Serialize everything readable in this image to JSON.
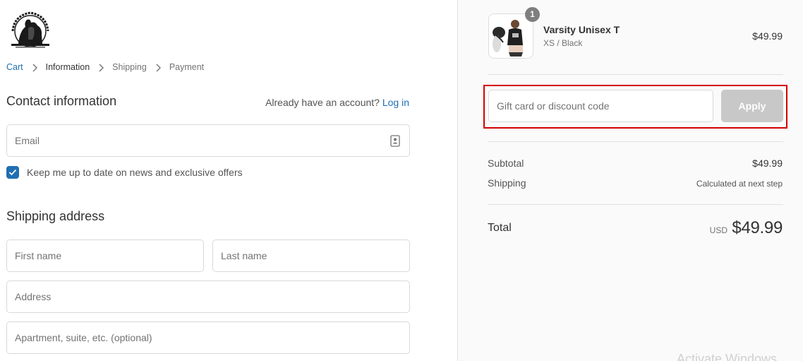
{
  "breadcrumb": {
    "items": [
      {
        "label": "Cart",
        "state": "link"
      },
      {
        "label": "Information",
        "state": "current"
      },
      {
        "label": "Shipping",
        "state": "upcoming"
      },
      {
        "label": "Payment",
        "state": "upcoming"
      }
    ]
  },
  "contact": {
    "title": "Contact information",
    "account_prompt": "Already have an account?",
    "login_label": "Log in",
    "email_placeholder": "Email",
    "newsletter_label": "Keep me up to date on news and exclusive offers",
    "newsletter_checked": true
  },
  "shipping": {
    "title": "Shipping address",
    "first_name_placeholder": "First name",
    "last_name_placeholder": "Last name",
    "address_placeholder": "Address",
    "apartment_placeholder": "Apartment, suite, etc. (optional)"
  },
  "order": {
    "item": {
      "name": "Varsity Unisex T",
      "variant": "XS / Black",
      "price": "$49.99",
      "quantity": "1"
    },
    "discount_placeholder": "Gift card or discount code",
    "apply_label": "Apply",
    "subtotal_label": "Subtotal",
    "subtotal_value": "$49.99",
    "shipping_label": "Shipping",
    "shipping_value": "Calculated at next step",
    "total_label": "Total",
    "total_currency": "USD",
    "total_value": "$49.99"
  },
  "watermark": "Activate Windows",
  "colors": {
    "link": "#1f6fb2",
    "highlight_outline": "#d40000",
    "apply_disabled": "#c8c8c8",
    "sidebar_bg": "#fafafa"
  }
}
